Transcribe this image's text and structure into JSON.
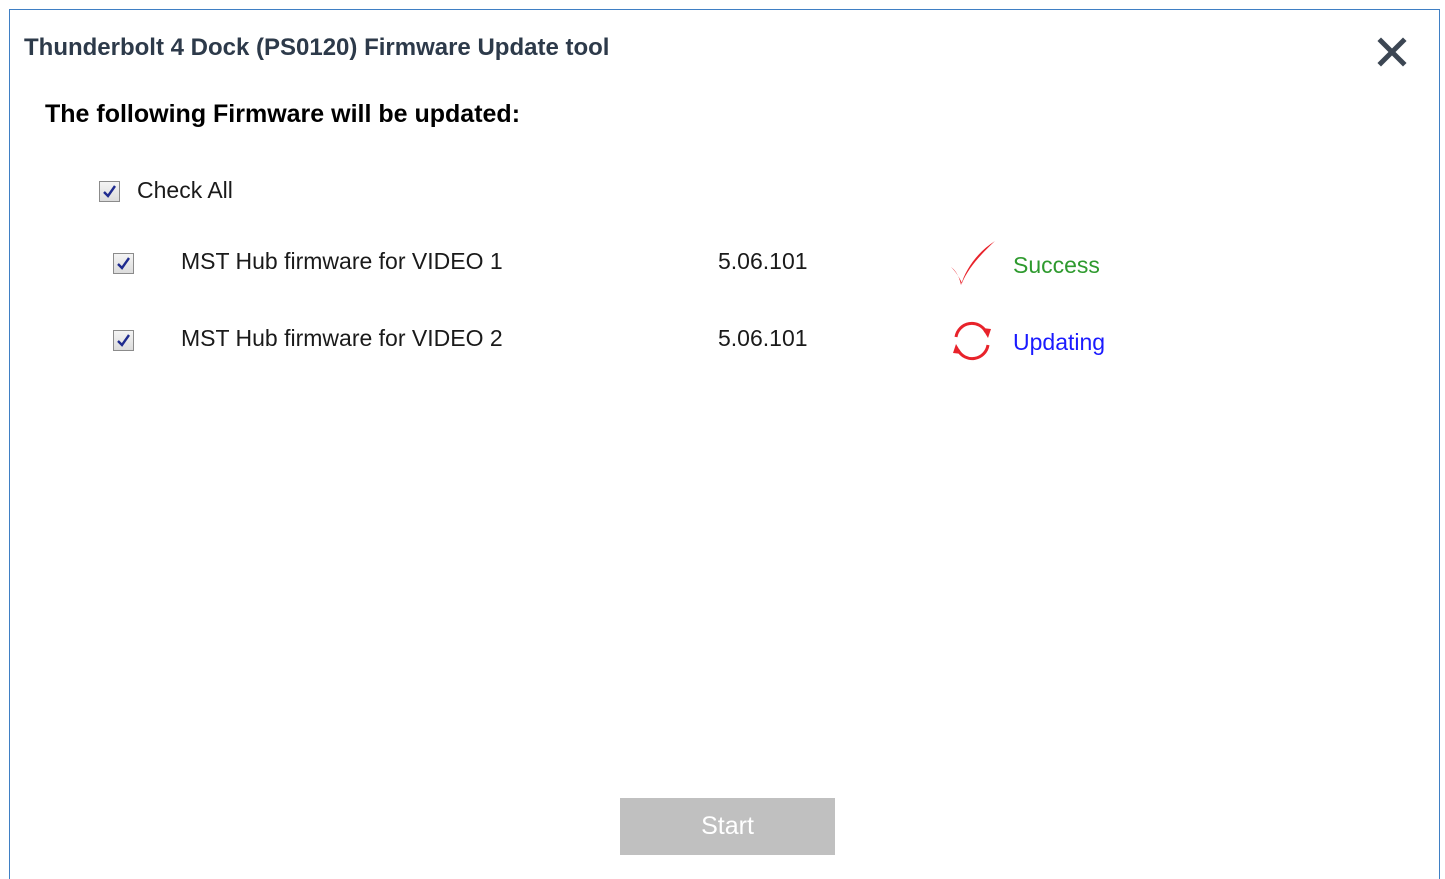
{
  "window": {
    "title": "Thunderbolt 4 Dock (PS0120) Firmware Update tool",
    "close_icon": "close-icon"
  },
  "main": {
    "heading": "The following Firmware will be updated:",
    "check_all": {
      "label": "Check All",
      "checked": true
    },
    "items": [
      {
        "label": "MST Hub firmware for VIDEO 1",
        "version": "5.06.101",
        "checked": true,
        "status_icon": "checkmark-icon",
        "status": "Success",
        "status_color": "#2e9a2e"
      },
      {
        "label": "MST Hub firmware for VIDEO 2",
        "version": "5.06.101",
        "checked": true,
        "status_icon": "refresh-icon",
        "status": "Updating",
        "status_color": "#1a1aff"
      }
    ]
  },
  "footer": {
    "start_label": "Start"
  },
  "colors": {
    "border": "#3f7fc4",
    "icon_red": "#e8232b",
    "button_disabled": "#c0c0c0"
  }
}
